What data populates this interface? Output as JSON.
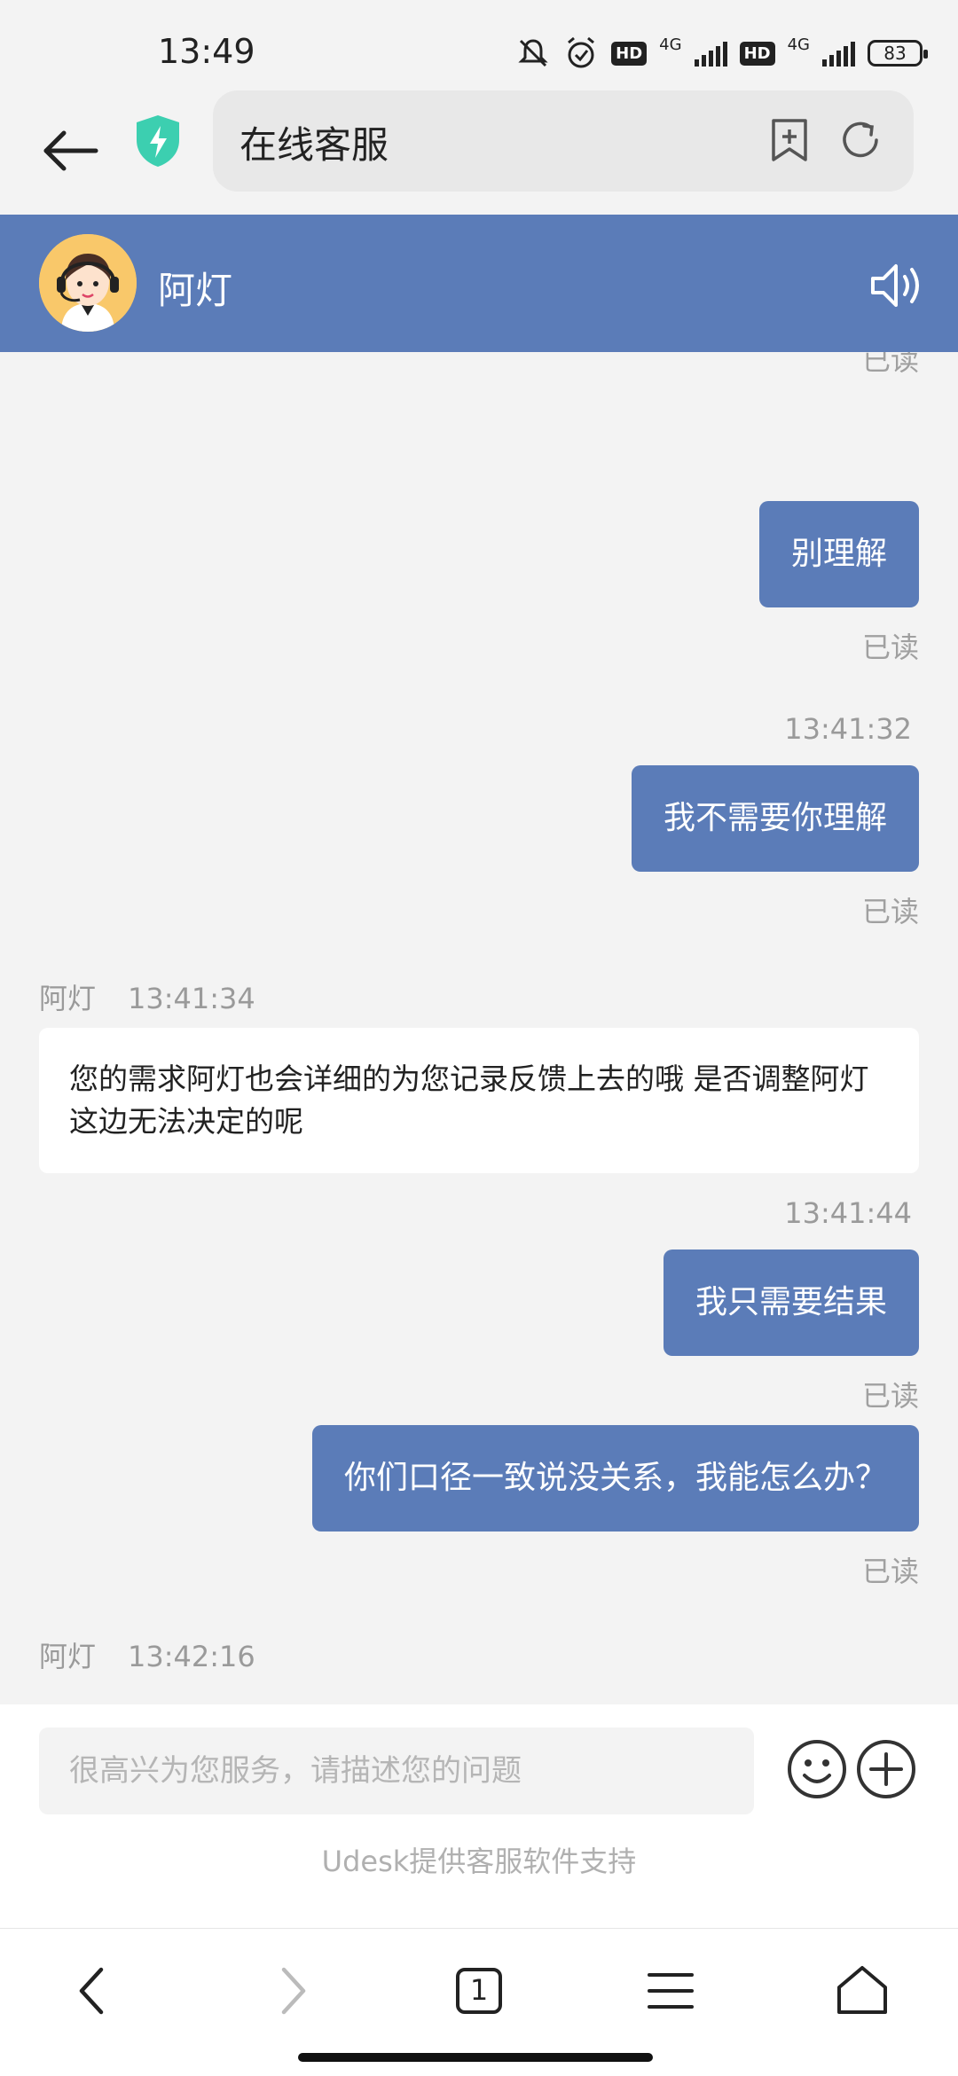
{
  "status_bar": {
    "time": "13:49",
    "network1": "4G",
    "network2": "4G",
    "hd_label": "HD",
    "battery": "83"
  },
  "browser": {
    "page_title": "在线客服"
  },
  "chat_header": {
    "agent_name": "阿灯"
  },
  "messages": [
    {
      "type": "read",
      "text": "已读"
    },
    {
      "type": "outgoing",
      "text": "别理解",
      "read": "已读"
    },
    {
      "type": "timestamp",
      "text": "13:41:32"
    },
    {
      "type": "outgoing",
      "text": "我不需要你理解",
      "read": "已读"
    },
    {
      "type": "incoming",
      "sender": "阿灯",
      "time": "13:41:34",
      "text": "您的需求阿灯也会详细的为您记录反馈上去的哦 是否调整阿灯这边无法决定的呢"
    },
    {
      "type": "timestamp",
      "text": "13:41:44"
    },
    {
      "type": "outgoing",
      "text": "我只需要结果",
      "read": "已读"
    },
    {
      "type": "outgoing",
      "text": "你们口径一致说没关系，我能怎么办？",
      "read": "已读"
    },
    {
      "type": "incoming_meta",
      "sender": "阿灯",
      "time": "13:42:16"
    }
  ],
  "input": {
    "placeholder": "很高兴为您服务，请描述您的问题",
    "powered_by": "Udesk提供客服软件支持"
  },
  "bottom_nav": {
    "tab_count": "1"
  },
  "colors": {
    "accent": "#5b7cb8",
    "background": "#f3f3f3",
    "shield": "#3ccfb0"
  }
}
